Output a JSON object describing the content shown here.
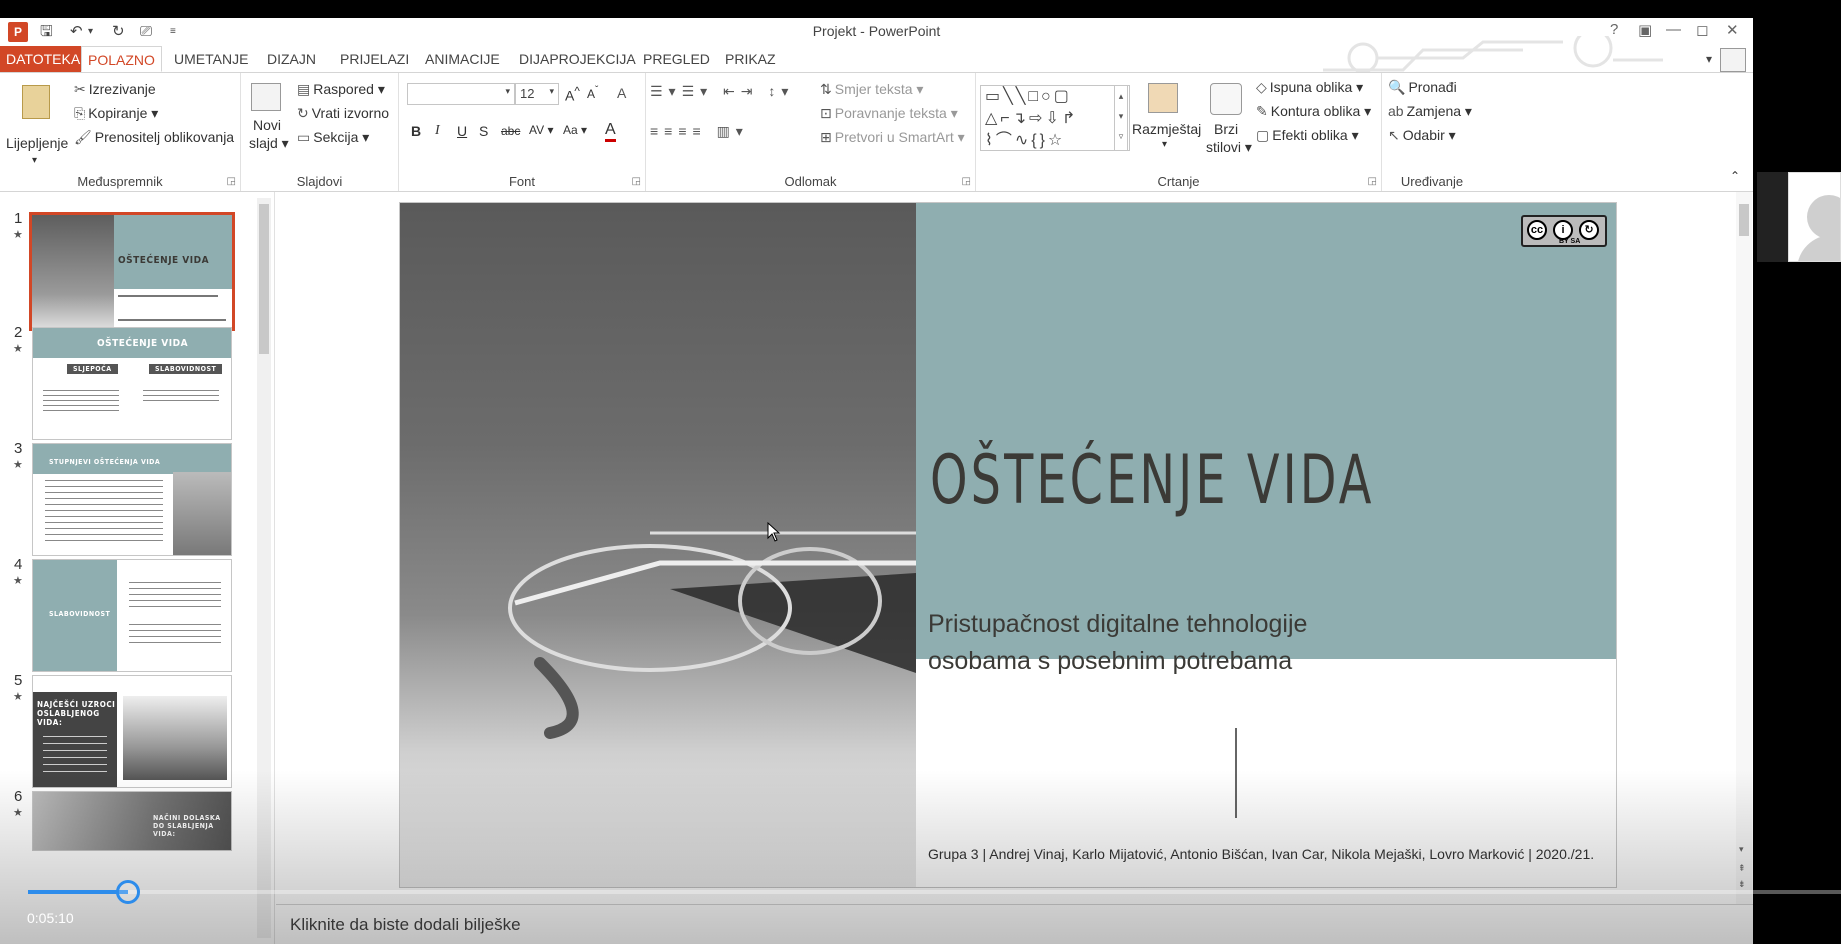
{
  "window": {
    "title": "Projekt - PowerPoint",
    "app_icon": "P",
    "controls": [
      "?",
      "▣",
      "—",
      "◻",
      "✕"
    ]
  },
  "tabs": [
    "DATOTEKA",
    "POLAZNO",
    "UMETANJE",
    "DIZAJN",
    "PRIJELAZI",
    "ANIMACIJE",
    "DIJAPROJEKCIJA",
    "PREGLED",
    "PRIKAZ"
  ],
  "active_tab": "POLAZNO",
  "ribbon": {
    "clipboard": {
      "label": "Međuspremnik",
      "paste": "Lijepljenje",
      "cut": "Izrezivanje",
      "copy": "Kopiranje",
      "format_painter": "Prenositelj oblikovanja"
    },
    "slides": {
      "label": "Slajdovi",
      "new_slide_1": "Novi",
      "new_slide_2": "slajd",
      "layout": "Raspored",
      "reset": "Vrati izvorno",
      "section": "Sekcija"
    },
    "font": {
      "label": "Font",
      "size": "12",
      "bold": "B",
      "italic": "I",
      "underline": "U",
      "shadow": "S",
      "strike": "abc",
      "spacing": "AV",
      "case": "Aa",
      "color": "A",
      "grow": "A",
      "shrink": "A",
      "clear": "A"
    },
    "paragraph": {
      "label": "Odlomak",
      "text_direction": "Smjer teksta",
      "align_text": "Poravnanje teksta",
      "smartart": "Pretvori u SmartArt"
    },
    "drawing": {
      "label": "Crtanje",
      "arrange": "Razmještaj",
      "quick_styles_1": "Brzi",
      "quick_styles_2": "stilovi",
      "fill": "Ispuna oblika",
      "outline": "Kontura oblika",
      "effects": "Efekti oblika"
    },
    "editing": {
      "label": "Uređivanje",
      "find": "Pronađi",
      "replace": "Zamjena",
      "select": "Odabir"
    }
  },
  "thumbnails": [
    {
      "num": "1",
      "title": "OŠTEĆENJE VIDA"
    },
    {
      "num": "2",
      "title": "OŠTEĆENJE VIDA",
      "tags": [
        "SLJEPOĆA",
        "SLABOVIDNOST"
      ]
    },
    {
      "num": "3",
      "title": "STUPNJEVI OŠTEĆENJA VIDA"
    },
    {
      "num": "4",
      "title": "SLABOVIDNOST"
    },
    {
      "num": "5",
      "title": "NAJČEŠĆI UZROCI OSLABLJENOG VIDA:"
    },
    {
      "num": "6",
      "title": "NAČINI DOLASKA DO SLABLJENJA VIDA:"
    }
  ],
  "slide": {
    "title": "OŠTEĆENJE VIDA",
    "subtitle_line1": "Pristupačnost digitalne tehnologije",
    "subtitle_line2": "osobama s posebnim potrebama",
    "footer": "Grupa 3 | Andrej Vinaj, Karlo Mijatović, Antonio Bišćan, Ivan Car, Nikola Mejaški, Lovro Marković | 2020./21.",
    "license_badge": "BY SA",
    "colors": {
      "accent": "#8faeb0",
      "title": "#3b3a36"
    }
  },
  "notes": {
    "placeholder": "Kliknite da biste dodali bilješke"
  },
  "video": {
    "time": "0:05:10",
    "progress_fraction": 0.055
  },
  "colors": {
    "brand": "#d24726",
    "progress": "#2d8ceb"
  }
}
